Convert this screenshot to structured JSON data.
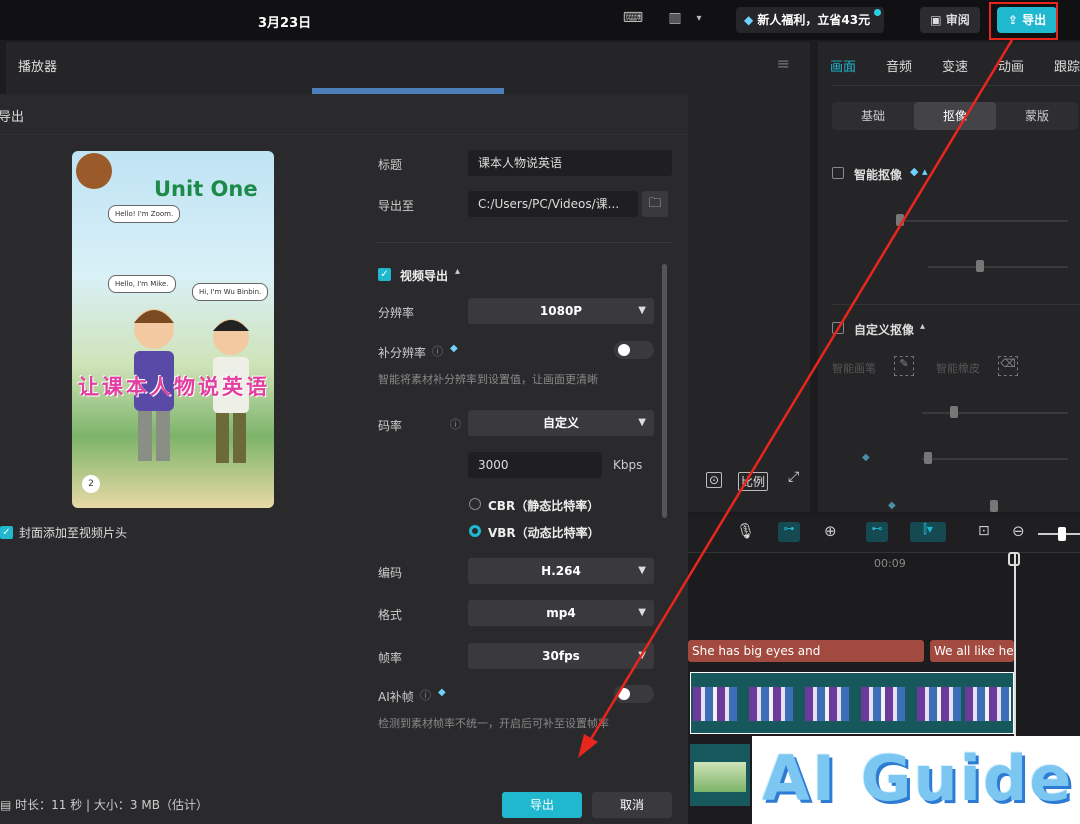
{
  "topbar": {
    "date": "3月23日",
    "promo": "新人福利，立省43元",
    "review": "审阅",
    "export": "导出"
  },
  "player": {
    "title": "播放器",
    "ratio_label": "比例"
  },
  "right_panel": {
    "tabs": [
      "画面",
      "音频",
      "变速",
      "动画",
      "跟踪"
    ],
    "subtabs": [
      "基础",
      "抠像",
      "蒙版"
    ],
    "smart_matting": "智能抠像",
    "custom_matting": "自定义抠像",
    "custom_tools": [
      "智能画笔",
      "智能橡皮"
    ]
  },
  "timeline": {
    "tick": "00:09",
    "captions": [
      "She has big eyes and",
      "We all like her"
    ]
  },
  "watermark": "AI Guide",
  "dialog": {
    "title": "导出",
    "cover": {
      "unit": "Unit One",
      "bubble1": "Hello! I'm Zoom.",
      "bubble2": "Hello, I'm Mike.",
      "bubble3": "Hi, I'm Wu Binbin.",
      "cn_title": "让课本人物说英语",
      "page_num": "2"
    },
    "cover_check": "封面添加至视频片头",
    "title_label": "标题",
    "title_value": "课本人物说英语",
    "export_to_label": "导出至",
    "export_path": "C:/Users/PC/Videos/课...",
    "video_export": "视频导出",
    "resolution_label": "分辨率",
    "resolution": "1080P",
    "super_res_label": "补分辨率",
    "super_res_hint": "智能将素材补分辨率到设置值，让画面更清晰",
    "bitrate_label": "码率",
    "bitrate": "自定义",
    "bitrate_value": "3000",
    "bitrate_unit": "Kbps",
    "cbr": "CBR（静态比特率）",
    "vbr": "VBR（动态比特率）",
    "codec_label": "编码",
    "codec": "H.264",
    "format_label": "格式",
    "format": "mp4",
    "fps_label": "帧率",
    "fps": "30fps",
    "ai_frame_label": "AI补帧",
    "ai_frame_hint": "检测到素材帧率不统一，开启后可补至设置帧率",
    "footer_info": "时长：11 秒 | 大小：3 MB（估计）",
    "confirm": "导出",
    "cancel": "取消"
  },
  "colors": {
    "accent": "#1fb8cf",
    "highlight": "#e8261d",
    "caption": "#a24a40",
    "track": "#16585c"
  }
}
